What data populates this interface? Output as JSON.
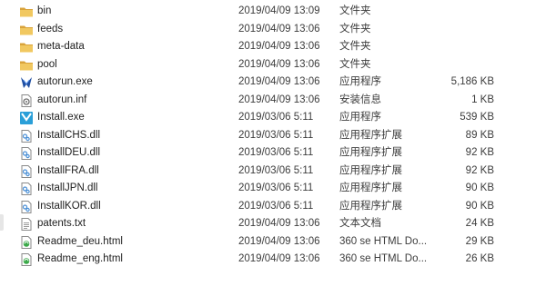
{
  "files": [
    {
      "name": "bin",
      "date": "2019/04/09 13:09",
      "type": "文件夹",
      "size": "",
      "icon": "folder-icon"
    },
    {
      "name": "feeds",
      "date": "2019/04/09 13:06",
      "type": "文件夹",
      "size": "",
      "icon": "folder-icon"
    },
    {
      "name": "meta-data",
      "date": "2019/04/09 13:06",
      "type": "文件夹",
      "size": "",
      "icon": "folder-icon"
    },
    {
      "name": "pool",
      "date": "2019/04/09 13:06",
      "type": "文件夹",
      "size": "",
      "icon": "folder-icon"
    },
    {
      "name": "autorun.exe",
      "date": "2019/04/09 13:06",
      "type": "应用程序",
      "size": "5,186 KB",
      "icon": "autorun-app-icon"
    },
    {
      "name": "autorun.inf",
      "date": "2019/04/09 13:06",
      "type": "安装信息",
      "size": "1 KB",
      "icon": "setup-info-icon"
    },
    {
      "name": "Install.exe",
      "date": "2019/03/06 5:11",
      "type": "应用程序",
      "size": "539 KB",
      "icon": "installer-app-icon"
    },
    {
      "name": "InstallCHS.dll",
      "date": "2019/03/06 5:11",
      "type": "应用程序扩展",
      "size": "89 KB",
      "icon": "dll-file-icon"
    },
    {
      "name": "InstallDEU.dll",
      "date": "2019/03/06 5:11",
      "type": "应用程序扩展",
      "size": "92 KB",
      "icon": "dll-file-icon"
    },
    {
      "name": "InstallFRA.dll",
      "date": "2019/03/06 5:11",
      "type": "应用程序扩展",
      "size": "92 KB",
      "icon": "dll-file-icon"
    },
    {
      "name": "InstallJPN.dll",
      "date": "2019/03/06 5:11",
      "type": "应用程序扩展",
      "size": "90 KB",
      "icon": "dll-file-icon"
    },
    {
      "name": "InstallKOR.dll",
      "date": "2019/03/06 5:11",
      "type": "应用程序扩展",
      "size": "90 KB",
      "icon": "dll-file-icon"
    },
    {
      "name": "patents.txt",
      "date": "2019/04/09 13:06",
      "type": "文本文档",
      "size": "24 KB",
      "icon": "text-file-icon"
    },
    {
      "name": "Readme_deu.html",
      "date": "2019/04/09 13:06",
      "type": "360 se HTML Do...",
      "size": "29 KB",
      "icon": "html-file-icon"
    },
    {
      "name": "Readme_eng.html",
      "date": "2019/04/09 13:06",
      "type": "360 se HTML Do...",
      "size": "26 KB",
      "icon": "html-file-icon"
    }
  ],
  "colors": {
    "folder": "#e8b84a",
    "folder_dark": "#d9a33a",
    "text": "#1e1e1e",
    "secondary_text": "#3c3c3c",
    "installer_blue": "#2a9fd8",
    "autorun_blue": "#1f4fa3",
    "html_green": "#3aa948"
  }
}
